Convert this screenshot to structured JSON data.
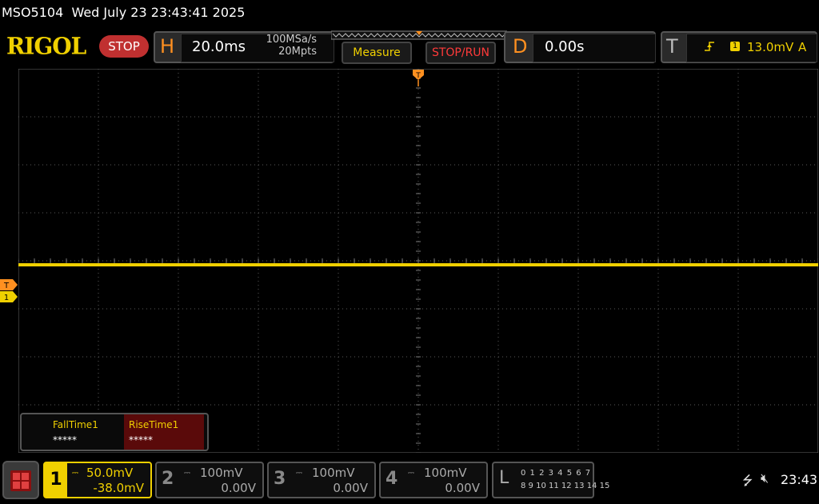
{
  "status": {
    "model": "MSO5104",
    "datetime": "Wed July 23 23:43:41 2025"
  },
  "brand": {
    "logo": "RIGOL",
    "run_state": "STOP"
  },
  "horizontal": {
    "letter": "H",
    "timebase": "20.0ms",
    "sample_rate": "100MSa/s",
    "memory_depth": "20Mpts"
  },
  "buttons": {
    "measure": "Measure",
    "stop_run": "STOP/RUN"
  },
  "delay": {
    "letter": "D",
    "value": "0.00s"
  },
  "trigger": {
    "letter": "T",
    "source": "1",
    "level": "13.0mV",
    "mode": "A"
  },
  "markers": {
    "trigger_top": "T",
    "trigger_level": "T",
    "ch1": "1"
  },
  "measurements": [
    {
      "name": "FallTime1",
      "value": "*****"
    },
    {
      "name": "RiseTime1",
      "value": "*****"
    }
  ],
  "channels": [
    {
      "num": "1",
      "scale": "50.0mV",
      "offset": "-38.0mV",
      "color": "#f0d000"
    },
    {
      "num": "2",
      "scale": "100mV",
      "offset": "0.00V",
      "color": "#888888"
    },
    {
      "num": "3",
      "scale": "100mV",
      "offset": "0.00V",
      "color": "#888888"
    },
    {
      "num": "4",
      "scale": "100mV",
      "offset": "0.00V",
      "color": "#888888"
    }
  ],
  "logic": {
    "letter": "L",
    "row1": "0 1 2 3  4 5 6 7",
    "row2": "8 9 10 11 12 13 14 15"
  },
  "system": {
    "usb_icon": "usb-icon",
    "mute_icon": "speaker-mute-icon",
    "clock": "23:43"
  },
  "colors": {
    "ch1": "#f0d000",
    "accent_orange": "#ff9020",
    "stop_red": "#c03030"
  }
}
